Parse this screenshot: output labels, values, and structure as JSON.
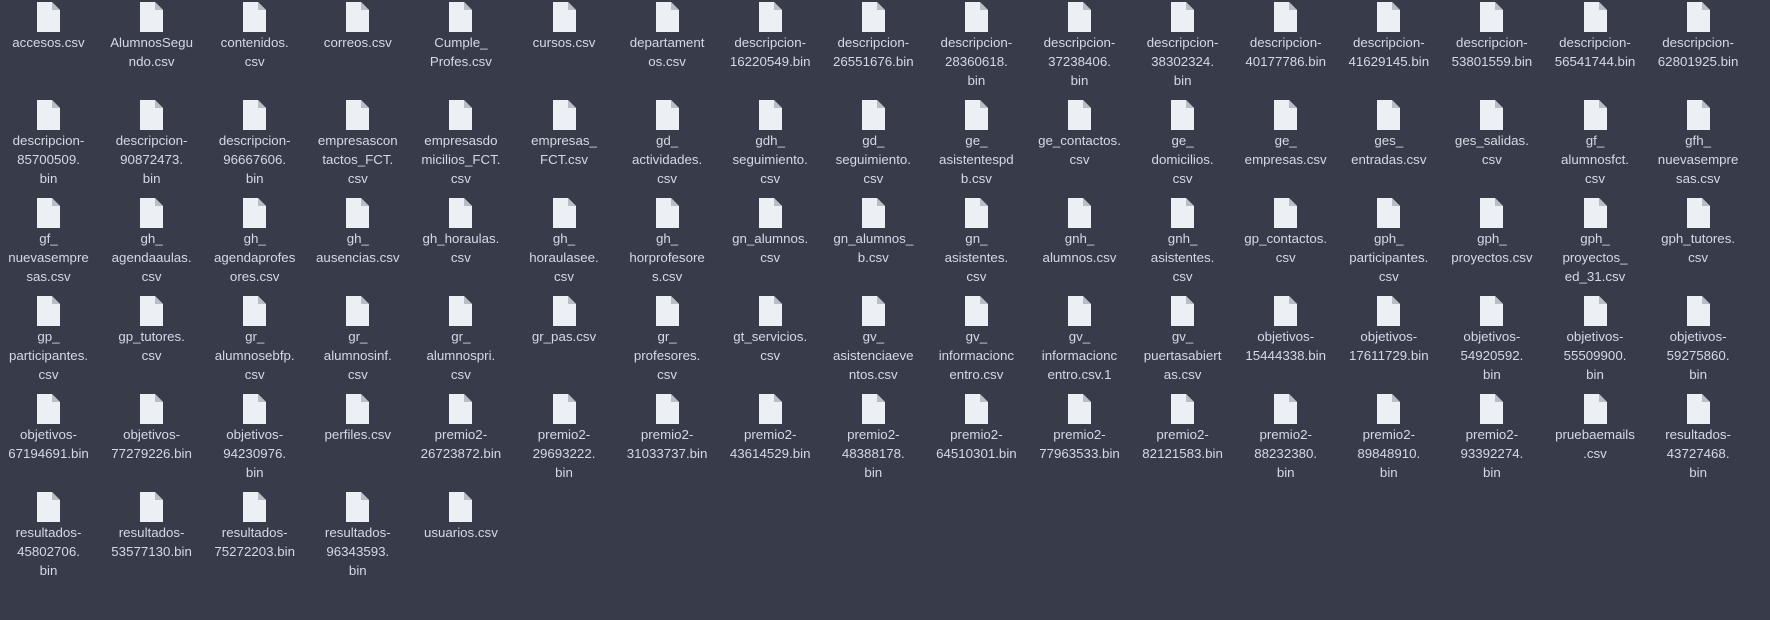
{
  "window": {
    "background_color": "#383c4a",
    "text_color": "#d3dae3",
    "icon_color": "#eceff3",
    "icon_fold_color": "#b9bec6"
  },
  "files": [
    {
      "icon": "document-file-icon",
      "lines": [
        "accesos.csv"
      ]
    },
    {
      "icon": "document-file-icon",
      "lines": [
        "AlumnosSegu",
        "ndo.csv"
      ]
    },
    {
      "icon": "document-file-icon",
      "lines": [
        "contenidos.",
        "csv"
      ]
    },
    {
      "icon": "document-file-icon",
      "lines": [
        "correos.csv"
      ]
    },
    {
      "icon": "document-file-icon",
      "lines": [
        "Cumple_",
        "Profes.csv"
      ]
    },
    {
      "icon": "document-file-icon",
      "lines": [
        "cursos.csv"
      ]
    },
    {
      "icon": "document-file-icon",
      "lines": [
        "departament",
        "os.csv"
      ]
    },
    {
      "icon": "document-file-icon",
      "lines": [
        "descripcion-",
        "16220549.bin"
      ]
    },
    {
      "icon": "document-file-icon",
      "lines": [
        "descripcion-",
        "26551676.bin"
      ]
    },
    {
      "icon": "document-file-icon",
      "lines": [
        "descripcion-",
        "28360618.",
        "bin"
      ]
    },
    {
      "icon": "document-file-icon",
      "lines": [
        "descripcion-",
        "37238406.",
        "bin"
      ]
    },
    {
      "icon": "document-file-icon",
      "lines": [
        "descripcion-",
        "38302324.",
        "bin"
      ]
    },
    {
      "icon": "document-file-icon",
      "lines": [
        "descripcion-",
        "40177786.bin"
      ]
    },
    {
      "icon": "document-file-icon",
      "lines": [
        "descripcion-",
        "41629145.bin"
      ]
    },
    {
      "icon": "document-file-icon",
      "lines": [
        "descripcion-",
        "53801559.bin"
      ]
    },
    {
      "icon": "document-file-icon",
      "lines": [
        "descripcion-",
        "56541744.bin"
      ]
    },
    {
      "icon": "document-file-icon",
      "lines": [
        "descripcion-",
        "62801925.bin"
      ]
    },
    {
      "icon": "document-file-icon",
      "lines": [
        "descripcion-",
        "85700509.",
        "bin"
      ]
    },
    {
      "icon": "document-file-icon",
      "lines": [
        "descripcion-",
        "90872473.",
        "bin"
      ]
    },
    {
      "icon": "document-file-icon",
      "lines": [
        "descripcion-",
        "96667606.",
        "bin"
      ]
    },
    {
      "icon": "document-file-icon",
      "lines": [
        "empresascon",
        "tactos_FCT.",
        "csv"
      ]
    },
    {
      "icon": "document-file-icon",
      "lines": [
        "empresasdo",
        "micilios_FCT.",
        "csv"
      ]
    },
    {
      "icon": "document-file-icon",
      "lines": [
        "empresas_",
        "FCT.csv"
      ]
    },
    {
      "icon": "document-file-icon",
      "lines": [
        "gd_",
        "actividades.",
        "csv"
      ]
    },
    {
      "icon": "document-file-icon",
      "lines": [
        "gdh_",
        "seguimiento.",
        "csv"
      ]
    },
    {
      "icon": "document-file-icon",
      "lines": [
        "gd_",
        "seguimiento.",
        "csv"
      ]
    },
    {
      "icon": "document-file-icon",
      "lines": [
        "ge_",
        "asistentespd",
        "b.csv"
      ]
    },
    {
      "icon": "document-file-icon",
      "lines": [
        "ge_contactos.",
        "csv"
      ]
    },
    {
      "icon": "document-file-icon",
      "lines": [
        "ge_",
        "domicilios.",
        "csv"
      ]
    },
    {
      "icon": "document-file-icon",
      "lines": [
        "ge_",
        "empresas.csv"
      ]
    },
    {
      "icon": "document-file-icon",
      "lines": [
        "ges_",
        "entradas.csv"
      ]
    },
    {
      "icon": "document-file-icon",
      "lines": [
        "ges_salidas.",
        "csv"
      ]
    },
    {
      "icon": "document-file-icon",
      "lines": [
        "gf_",
        "alumnosfct.",
        "csv"
      ]
    },
    {
      "icon": "document-file-icon",
      "lines": [
        "gfh_",
        "nuevasempre",
        "sas.csv"
      ]
    },
    {
      "icon": "document-file-icon",
      "lines": [
        "gf_",
        "nuevasempre",
        "sas.csv"
      ]
    },
    {
      "icon": "document-file-icon",
      "lines": [
        "gh_",
        "agendaaulas.",
        "csv"
      ]
    },
    {
      "icon": "document-file-icon",
      "lines": [
        "gh_",
        "agendaprofes",
        "ores.csv"
      ]
    },
    {
      "icon": "document-file-icon",
      "lines": [
        "gh_",
        "ausencias.csv"
      ]
    },
    {
      "icon": "document-file-icon",
      "lines": [
        "gh_horaulas.",
        "csv"
      ]
    },
    {
      "icon": "document-file-icon",
      "lines": [
        "gh_",
        "horaulasee.",
        "csv"
      ]
    },
    {
      "icon": "document-file-icon",
      "lines": [
        "gh_",
        "horprofesore",
        "s.csv"
      ]
    },
    {
      "icon": "document-file-icon",
      "lines": [
        "gn_alumnos.",
        "csv"
      ]
    },
    {
      "icon": "document-file-icon",
      "lines": [
        "gn_alumnos_",
        "b.csv"
      ]
    },
    {
      "icon": "document-file-icon",
      "lines": [
        "gn_",
        "asistentes.",
        "csv"
      ]
    },
    {
      "icon": "document-file-icon",
      "lines": [
        "gnh_",
        "alumnos.csv"
      ]
    },
    {
      "icon": "document-file-icon",
      "lines": [
        "gnh_",
        "asistentes.",
        "csv"
      ]
    },
    {
      "icon": "document-file-icon",
      "lines": [
        "gp_contactos.",
        "csv"
      ]
    },
    {
      "icon": "document-file-icon",
      "lines": [
        "gph_",
        "participantes.",
        "csv"
      ]
    },
    {
      "icon": "document-file-icon",
      "lines": [
        "gph_",
        "proyectos.csv"
      ]
    },
    {
      "icon": "document-file-icon",
      "lines": [
        "gph_",
        "proyectos_",
        "ed_31.csv"
      ]
    },
    {
      "icon": "document-file-icon",
      "lines": [
        "gph_tutores.",
        "csv"
      ]
    },
    {
      "icon": "document-file-icon",
      "lines": [
        "gp_",
        "participantes.",
        "csv"
      ]
    },
    {
      "icon": "document-file-icon",
      "lines": [
        "gp_tutores.",
        "csv"
      ]
    },
    {
      "icon": "document-file-icon",
      "lines": [
        "gr_",
        "alumnosebfp.",
        "csv"
      ]
    },
    {
      "icon": "document-file-icon",
      "lines": [
        "gr_",
        "alumnosinf.",
        "csv"
      ]
    },
    {
      "icon": "document-file-icon",
      "lines": [
        "gr_",
        "alumnospri.",
        "csv"
      ]
    },
    {
      "icon": "document-file-icon",
      "lines": [
        "gr_pas.csv"
      ]
    },
    {
      "icon": "document-file-icon",
      "lines": [
        "gr_",
        "profesores.",
        "csv"
      ]
    },
    {
      "icon": "document-file-icon",
      "lines": [
        "gt_servicios.",
        "csv"
      ]
    },
    {
      "icon": "document-file-icon",
      "lines": [
        "gv_",
        "asistenciaeve",
        "ntos.csv"
      ]
    },
    {
      "icon": "document-file-icon",
      "lines": [
        "gv_",
        "informacionc",
        "entro.csv"
      ]
    },
    {
      "icon": "document-file-icon",
      "lines": [
        "gv_",
        "informacionc",
        "entro.csv.1"
      ]
    },
    {
      "icon": "document-file-icon",
      "lines": [
        "gv_",
        "puertasabiert",
        "as.csv"
      ]
    },
    {
      "icon": "document-file-icon",
      "lines": [
        "objetivos-",
        "15444338.bin"
      ]
    },
    {
      "icon": "document-file-icon",
      "lines": [
        "objetivos-",
        "17611729.bin"
      ]
    },
    {
      "icon": "document-file-icon",
      "lines": [
        "objetivos-",
        "54920592.",
        "bin"
      ]
    },
    {
      "icon": "document-file-icon",
      "lines": [
        "objetivos-",
        "55509900.",
        "bin"
      ]
    },
    {
      "icon": "document-file-icon",
      "lines": [
        "objetivos-",
        "59275860.",
        "bin"
      ]
    },
    {
      "icon": "document-file-icon",
      "lines": [
        "objetivos-",
        "67194691.bin"
      ]
    },
    {
      "icon": "document-file-icon",
      "lines": [
        "objetivos-",
        "77279226.bin"
      ]
    },
    {
      "icon": "document-file-icon",
      "lines": [
        "objetivos-",
        "94230976.",
        "bin"
      ]
    },
    {
      "icon": "document-file-icon",
      "lines": [
        "perfiles.csv"
      ]
    },
    {
      "icon": "document-file-icon",
      "lines": [
        "premio2-",
        "26723872.bin"
      ]
    },
    {
      "icon": "document-file-icon",
      "lines": [
        "premio2-",
        "29693222.",
        "bin"
      ]
    },
    {
      "icon": "document-file-icon",
      "lines": [
        "premio2-",
        "31033737.bin"
      ]
    },
    {
      "icon": "document-file-icon",
      "lines": [
        "premio2-",
        "43614529.bin"
      ]
    },
    {
      "icon": "document-file-icon",
      "lines": [
        "premio2-",
        "48388178.",
        "bin"
      ]
    },
    {
      "icon": "document-file-icon",
      "lines": [
        "premio2-",
        "64510301.bin"
      ]
    },
    {
      "icon": "document-file-icon",
      "lines": [
        "premio2-",
        "77963533.bin"
      ]
    },
    {
      "icon": "document-file-icon",
      "lines": [
        "premio2-",
        "82121583.bin"
      ]
    },
    {
      "icon": "document-file-icon",
      "lines": [
        "premio2-",
        "88232380.",
        "bin"
      ]
    },
    {
      "icon": "document-file-icon",
      "lines": [
        "premio2-",
        "89848910.",
        "bin"
      ]
    },
    {
      "icon": "document-file-icon",
      "lines": [
        "premio2-",
        "93392274.",
        "bin"
      ]
    },
    {
      "icon": "document-file-icon",
      "lines": [
        "pruebaemails",
        ".csv"
      ]
    },
    {
      "icon": "document-file-icon",
      "lines": [
        "resultados-",
        "43727468.",
        "bin"
      ]
    },
    {
      "icon": "document-file-icon",
      "lines": [
        "resultados-",
        "45802706.",
        "bin"
      ]
    },
    {
      "icon": "document-file-icon",
      "lines": [
        "resultados-",
        "53577130.bin"
      ]
    },
    {
      "icon": "document-file-icon",
      "lines": [
        "resultados-",
        "75272203.bin"
      ]
    },
    {
      "icon": "document-file-icon",
      "lines": [
        "resultados-",
        "96343593.",
        "bin"
      ]
    },
    {
      "icon": "document-file-icon",
      "lines": [
        "usuarios.csv"
      ]
    }
  ]
}
